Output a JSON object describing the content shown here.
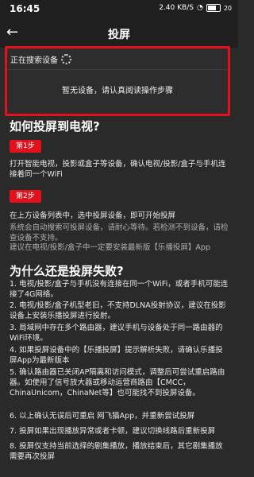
{
  "status": {
    "time": "16:45",
    "right": "2.40 KB/S",
    "battery": "20"
  },
  "nav": {
    "title": "投屏"
  },
  "search": {
    "searching": "正在搜索设备",
    "no_device": "暂无设备，请认真阅读操作步骤"
  },
  "how": {
    "title": "如何投屏到电视?",
    "step1_label": "第1步",
    "step1_text": "打开智能电视，投影或盒子等设备，确认电视/投影/盒子与手机连接着同一个WiFi",
    "step2_label": "第2步",
    "step2_text": "在上方设备列表中，选中投屏设备，即可开始投屏",
    "step2_note": "系统会自动搜索可投屏设备，请耐心等待。若检测不到设备，请检查设备不支持。",
    "step2_note2": "建议在电视/投影/盒子中一定要安装最新版【乐播投屏】App"
  },
  "fail": {
    "title": "为什么还是投屏失败?",
    "items": [
      "1. 电视/投影/盒子与手机没有连接在同一个WiFi，或者手机可能连接了4G网络。",
      "2. 电视/投影/盒子机型老旧，不支持DLNA投射协议，建议在投影设备上安装乐播投屏进行投射。",
      "3. 局域网中存在多个路由器，建议手机与设备处于同一路由器的WiFi环境。",
      "4. 如果投屏设备中的【乐播投屏】提示解析失败，请确认乐播投屏App为最新版本",
      "5. 确认路由器已关闭AP隔离和访问模式，调整后可尝试重启路由器。如使用了信号放大器或移动运营商路由【CMCC，ChinaUnicom，ChinaNet等】也可能找不到投屏设备。",
      "6. 以上确认无误后可重启 网飞猫App，并重新尝试投屏",
      "7. 投屏如果出现播放异常或者卡顿，建议切换线路后重新投屏",
      "8. 投屏仅支持当前选择的剧集播放，播放结束后，其它剧集播放需要再次投屏"
    ]
  }
}
